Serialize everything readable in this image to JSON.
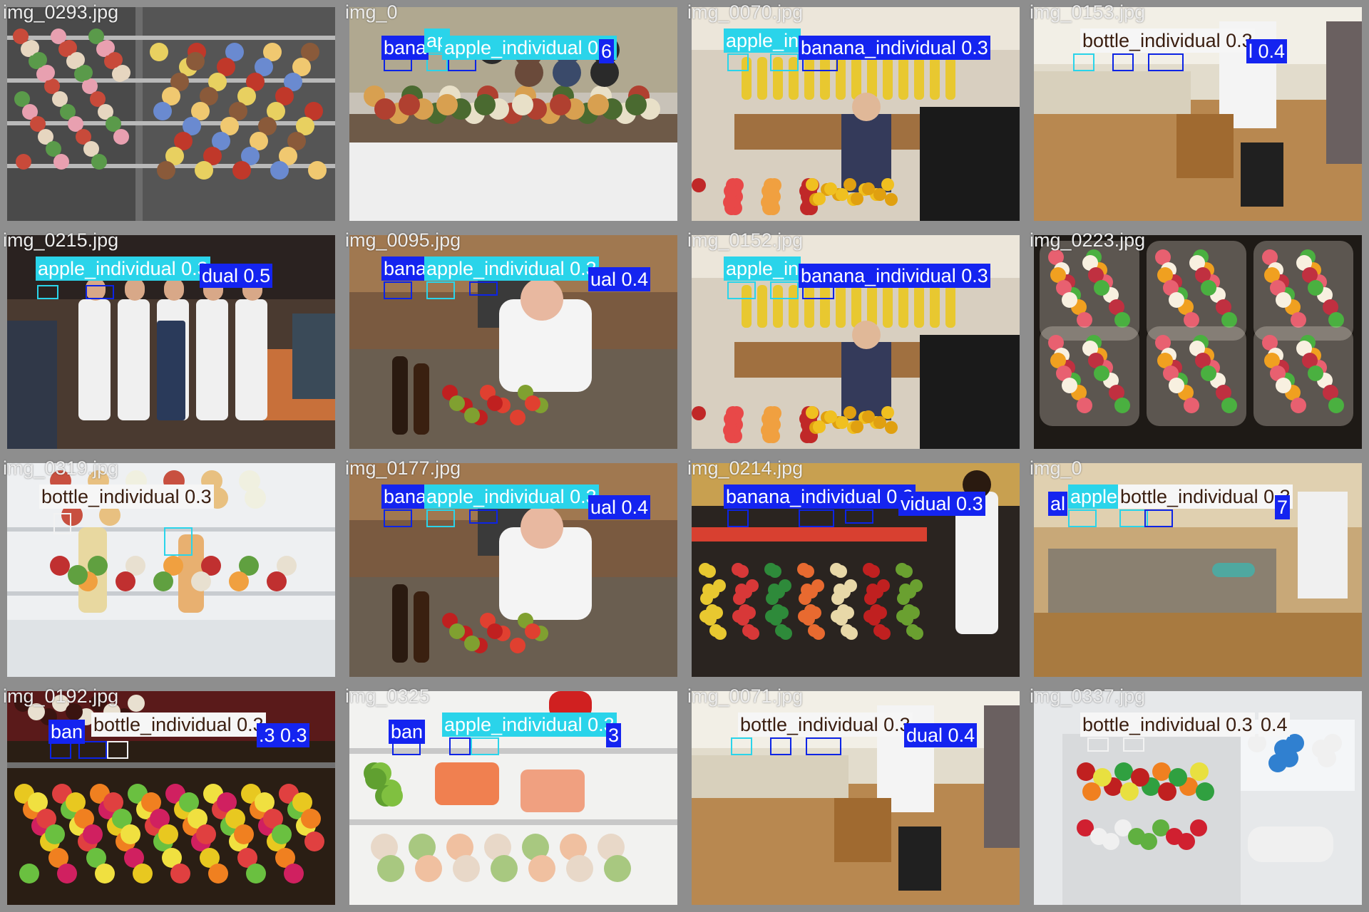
{
  "palette": {
    "banana_individual": "#1424f0",
    "apple_individual": "#2ad4ea",
    "bottle_individual": "#f6f6f6",
    "tile_border": "#8e8e8e",
    "filename_text": "#ececec"
  },
  "tiles": [
    {
      "filename": "img_0293.jpg",
      "scene": "fridge-drinks-sandwiches",
      "labels": []
    },
    {
      "filename": "img_0",
      "scene": "kitchen-party-buffet",
      "labels": [
        {
          "text": "bana",
          "cls": "blue"
        },
        {
          "text": "ap",
          "cls": "cyan"
        },
        {
          "text": "apple_individual 0.3",
          "cls": "cyan"
        },
        {
          "text": "6",
          "cls": "blue"
        }
      ]
    },
    {
      "filename": "img_0070.jpg",
      "scene": "fruit-shop-cashier",
      "labels": [
        {
          "text": "apple_in",
          "cls": "cyan"
        },
        {
          "text": "banana_individual 0.3",
          "cls": "blue"
        }
      ]
    },
    {
      "filename": "img_0153.jpg",
      "scene": "empty-kitchen-wood-floor",
      "labels": [
        {
          "text": "bottle_individual 0.3",
          "cls": "white"
        },
        {
          "text": "l 0.4",
          "cls": "blue"
        }
      ]
    },
    {
      "filename": "img_0215.jpg",
      "scene": "chefs-in-market",
      "labels": [
        {
          "text": "apple_individual 0.3",
          "cls": "cyan"
        },
        {
          "text": "dual 0.5",
          "cls": "blue"
        }
      ]
    },
    {
      "filename": "img_0095.jpg",
      "scene": "man-cooking-kitchen",
      "labels": [
        {
          "text": "bana",
          "cls": "blue"
        },
        {
          "text": "apple_individual 0.3",
          "cls": "cyan"
        },
        {
          "text": "ual 0.4",
          "cls": "blue"
        }
      ]
    },
    {
      "filename": "img_0152.jpg",
      "scene": "fruit-shop-cashier",
      "labels": [
        {
          "text": "apple_in",
          "cls": "cyan"
        },
        {
          "text": "banana_individual 0.3",
          "cls": "blue"
        }
      ]
    },
    {
      "filename": "img_0223.jpg",
      "scene": "salad-containers",
      "labels": []
    },
    {
      "filename": "img_0319.jpg",
      "scene": "open-fridge-shelves",
      "labels": [
        {
          "text": "bottle_individual 0.3",
          "cls": "white"
        }
      ]
    },
    {
      "filename": "img_0177.jpg",
      "scene": "man-cooking-kitchen",
      "labels": [
        {
          "text": "bana",
          "cls": "blue"
        },
        {
          "text": "apple_individual 0.3",
          "cls": "cyan"
        },
        {
          "text": "ual 0.4",
          "cls": "blue"
        }
      ]
    },
    {
      "filename": "img_0214.jpg",
      "scene": "street-fruit-stall",
      "labels": [
        {
          "text": "banana_individual 0.3",
          "cls": "blue"
        },
        {
          "text": "vidual 0.3",
          "cls": "blue"
        }
      ]
    },
    {
      "filename": "img_0",
      "scene": "kitchen-island",
      "labels": [
        {
          "text": "al",
          "cls": "blue"
        },
        {
          "text": "apple",
          "cls": "cyan"
        },
        {
          "text": "bottle_individual 0.3",
          "cls": "white"
        },
        {
          "text": "7",
          "cls": "blue"
        }
      ]
    },
    {
      "filename": "img_0192.jpg",
      "scene": "fruit-display-case",
      "labels": [
        {
          "text": "ban",
          "cls": "blue"
        },
        {
          "text": "bottle_individual 0.3",
          "cls": "white"
        },
        {
          "text": ".3 0.3",
          "cls": "blue"
        }
      ]
    },
    {
      "filename": "img_0325",
      "scene": "fridge-vegetables-closeup",
      "labels": [
        {
          "text": "ban",
          "cls": "blue"
        },
        {
          "text": "apple_individual 0.3",
          "cls": "cyan"
        },
        {
          "text": "3",
          "cls": "blue"
        }
      ]
    },
    {
      "filename": "img_0071.jpg",
      "scene": "empty-kitchen-wood-floor",
      "labels": [
        {
          "text": "bottle_individual 0.3",
          "cls": "white"
        },
        {
          "text": "dual 0.4",
          "cls": "blue"
        }
      ]
    },
    {
      "filename": "img_0337.jpg",
      "scene": "open-fridge-produce",
      "labels": [
        {
          "text": "bottle_individual 0.3",
          "cls": "white"
        },
        {
          "text": "0.4",
          "cls": "white"
        }
      ]
    }
  ]
}
